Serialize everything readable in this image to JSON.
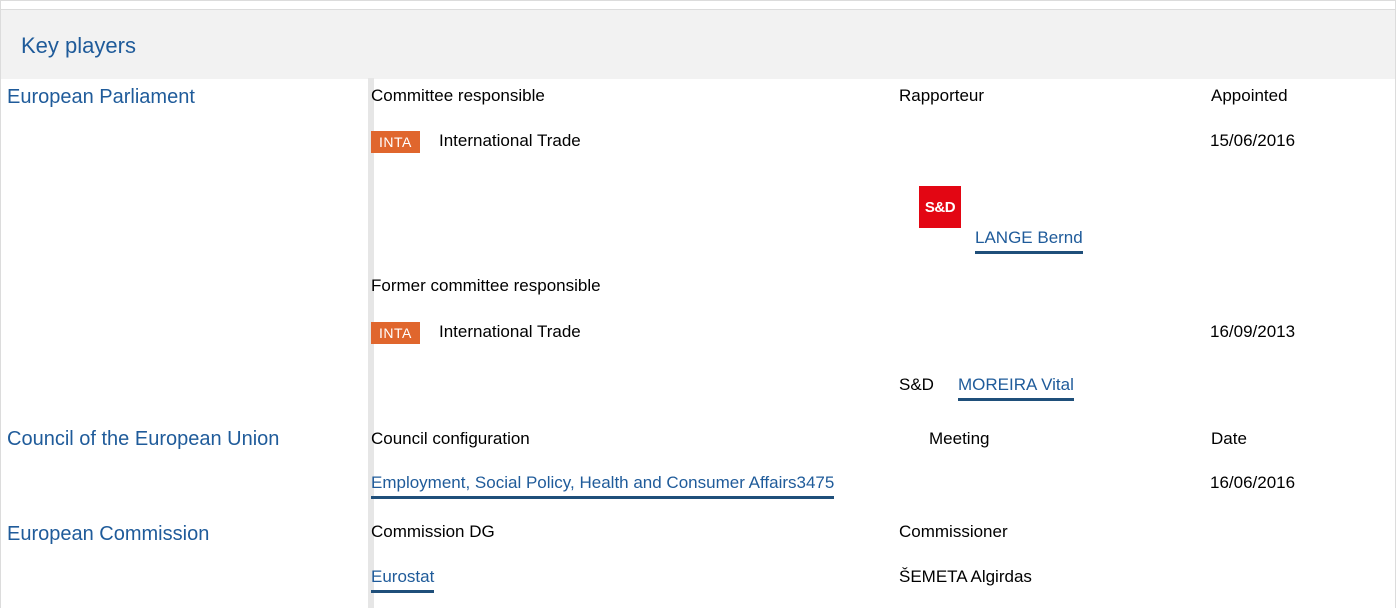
{
  "header": {
    "title": "Key players"
  },
  "parliament": {
    "title": "European Parliament",
    "col_committee": "Committee responsible",
    "col_rapporteur": "Rapporteur",
    "col_appointed": "Appointed",
    "committee_badge": "INTA",
    "committee_name": "International Trade",
    "appointed_date": "15/06/2016",
    "party_logo": "S&D",
    "rapporteur_link": "LANGE Bernd",
    "former_label": "Former committee responsible",
    "former_badge": "INTA",
    "former_committee_name": "International Trade",
    "former_date": "16/09/2013",
    "former_party": "S&D",
    "former_rapporteur_link": "MOREIRA Vital"
  },
  "council": {
    "title": "Council of the European Union",
    "col_configuration": "Council configuration",
    "col_meeting": "Meeting",
    "col_date": "Date",
    "configuration_link": "Employment, Social Policy, Health and Consumer Affairs3475",
    "date": "16/06/2016"
  },
  "commission": {
    "title": "European Commission",
    "col_dg": "Commission DG",
    "col_commissioner": "Commissioner",
    "dg_link": "Eurostat",
    "commissioner": "ŠEMETA Algirdas"
  },
  "colors": {
    "heading_blue": "#1f5b9a",
    "badge_orange": "#e0662d",
    "sd_red": "#e30613",
    "header_bg": "#f2f2f2"
  }
}
